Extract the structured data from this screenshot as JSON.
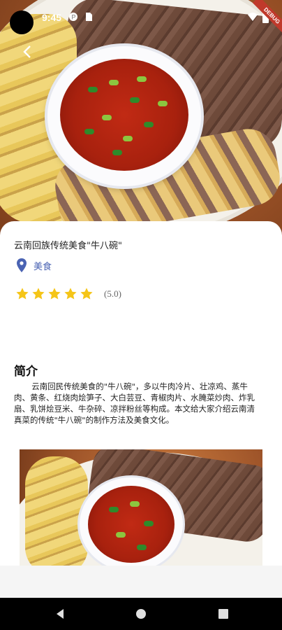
{
  "status_bar": {
    "time": "9:45",
    "debug_label": "DEBUG"
  },
  "dish": {
    "title": "云南回族传统美食\"牛八碗\"",
    "category": "美食",
    "rating_stars": 5,
    "rating_text": "(5.0)"
  },
  "intro": {
    "heading": "简介",
    "text": "云南回民传统美食的\"牛八碗\"，多以牛肉冷片、壮凉鸡、蒸牛肉、黄条、红烧肉烩笋子、大白芸豆、青椒肉片、水腌菜炒肉、炸乳扇、乳饼烩豆米、牛杂碎、凉拌粉丝等构成。本文给大家介绍云南清真菜的传统\"牛八碗\"的制作方法及美食文化。"
  },
  "colors": {
    "accent": "#4a63b3",
    "star": "#f5c518"
  },
  "icons": [
    "back-arrow-icon",
    "location-pin-icon",
    "star-icon",
    "wifi-icon",
    "battery-icon",
    "nav-back-icon",
    "nav-home-icon",
    "nav-recents-icon"
  ]
}
